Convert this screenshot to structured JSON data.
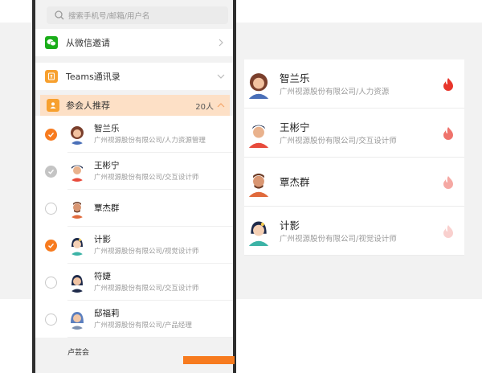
{
  "search": {
    "placeholder": "搜索手机号/邮箱/用户名"
  },
  "invite_rows": [
    {
      "label": "从微信邀请",
      "icon": "wechat-icon",
      "color": "#1aad19"
    },
    {
      "label": "Teams通讯录",
      "icon": "contacts-book-icon",
      "color": "#f7a02e"
    }
  ],
  "recommend": {
    "label": "参会人推荐",
    "count": "20人",
    "icon": "user-icon",
    "color": "#f7a02e"
  },
  "people": [
    {
      "name": "智兰乐",
      "org": "广州视源股份有限公司/人力资源管理",
      "state": "checked"
    },
    {
      "name": "王彬宁",
      "org": "广州视源股份有限公司/交互设计师",
      "state": "disabled"
    },
    {
      "name": "覃杰群",
      "org": "",
      "state": "unchecked"
    },
    {
      "name": "计影",
      "org": "广州视源股份有限公司/视觉设计师",
      "state": "checked"
    },
    {
      "name": "符婕",
      "org": "广州视源股份有限公司/交互设计师",
      "state": "unchecked"
    },
    {
      "name": "邸福莉",
      "org": "广州视源股份有限公司/产品经理",
      "state": "unchecked"
    }
  ],
  "peek_name": "卢芸会",
  "panel": [
    {
      "name": "智兰乐",
      "org": "广州视源股份有限公司/人力资源",
      "heat": 1.0
    },
    {
      "name": "王彬宁",
      "org": "广州视源股份有限公司/交互设计师",
      "heat": 0.65
    },
    {
      "name": "覃杰群",
      "org": "",
      "heat": 0.35
    },
    {
      "name": "计影",
      "org": "广州视源股份有限公司/视觉设计师",
      "heat": 0.12
    }
  ],
  "colors": {
    "accent": "#f77b1f",
    "flame": "#e8352b",
    "highlight": "#fde0c6"
  }
}
